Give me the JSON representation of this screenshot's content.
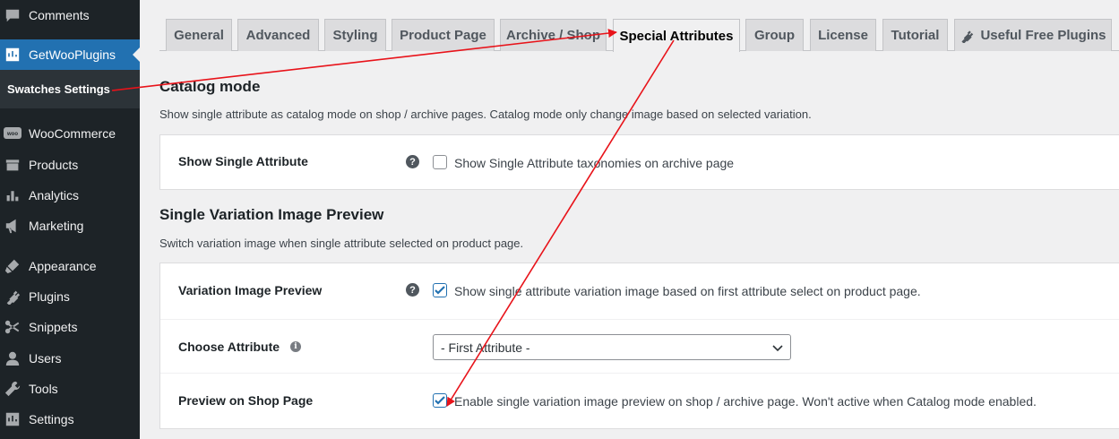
{
  "sidebar": {
    "items": [
      {
        "label": "Comments",
        "icon": "comments-icon"
      },
      {
        "label": "GetWooPlugins",
        "icon": "getwooplugins-icon"
      },
      {
        "label": "WooCommerce",
        "icon": "woocommerce-icon"
      },
      {
        "label": "Products",
        "icon": "products-icon"
      },
      {
        "label": "Analytics",
        "icon": "analytics-icon"
      },
      {
        "label": "Marketing",
        "icon": "marketing-icon"
      },
      {
        "label": "Appearance",
        "icon": "appearance-icon"
      },
      {
        "label": "Plugins",
        "icon": "plugins-icon"
      },
      {
        "label": "Snippets",
        "icon": "snippets-icon"
      },
      {
        "label": "Users",
        "icon": "users-icon"
      },
      {
        "label": "Tools",
        "icon": "tools-icon"
      },
      {
        "label": "Settings",
        "icon": "settings-icon"
      }
    ],
    "submenu": {
      "label": "Swatches Settings"
    }
  },
  "tabs": [
    {
      "label": "General"
    },
    {
      "label": "Advanced"
    },
    {
      "label": "Styling"
    },
    {
      "label": "Product Page"
    },
    {
      "label": "Archive / Shop"
    },
    {
      "label": "Special Attributes",
      "active": true
    },
    {
      "label": "Group"
    },
    {
      "label": "License"
    },
    {
      "label": "Tutorial"
    },
    {
      "label": "Useful Free Plugins",
      "icon": "plugin-icon"
    }
  ],
  "catalog": {
    "title": "Catalog mode",
    "description": "Show single attribute as catalog mode on shop / archive pages. Catalog mode only change image based on selected variation.",
    "rows": [
      {
        "label": "Show Single Attribute",
        "checkbox_label": "Show Single Attribute taxonomies on archive page",
        "checked": false
      }
    ]
  },
  "variation": {
    "title": "Single Variation Image Preview",
    "description": "Switch variation image when single attribute selected on product page.",
    "image_preview": {
      "label": "Variation Image Preview",
      "checkbox_label": "Show single attribute variation image based on first attribute select on product page.",
      "checked": true
    },
    "choose_attribute": {
      "label": "Choose Attribute",
      "selected": "- First Attribute -"
    },
    "shop_preview": {
      "label": "Preview on Shop Page",
      "checkbox_label": "Enable single variation image preview on shop / archive page. Won't active when Catalog mode enabled.",
      "checked": true
    }
  },
  "colors": {
    "accent": "#2271b1",
    "sidebar_bg": "#1d2327",
    "annotation_arrow": "#e8131a"
  }
}
